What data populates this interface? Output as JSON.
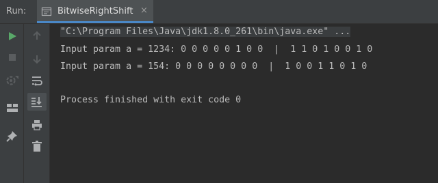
{
  "run_panel": {
    "label": "Run:",
    "tab_title": "BitwiseRightShift",
    "close_glyph": "×"
  },
  "toolbar_left": [
    "run-icon",
    "stop-icon",
    "rerun-icon",
    "layout-icon",
    "pin-icon"
  ],
  "toolbar_right": [
    "up-arrow-icon",
    "down-arrow-icon",
    "soft-wrap-icon",
    "scroll-to-end-icon",
    "print-icon",
    "trash-icon"
  ],
  "console": {
    "command": "\"C:\\Program Files\\Java\\jdk1.8.0_261\\bin\\java.exe\" ...",
    "lines": [
      "Input param a = 1234: 0 0 0 0 0 1 0 0  |  1 1 0 1 0 0 1 0",
      "Input param a = 154: 0 0 0 0 0 0 0 0  |  1 0 0 1 1 0 1 0"
    ],
    "exit_message": "Process finished with exit code 0"
  },
  "colors": {
    "run_green": "#59a869",
    "accent_blue": "#4a88c7",
    "text": "#bbbbbb"
  }
}
